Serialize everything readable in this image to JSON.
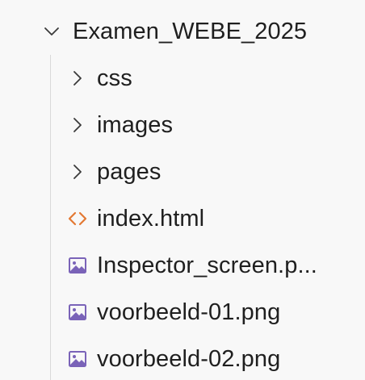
{
  "explorer": {
    "root": {
      "label": "Examen_WEBE_2025",
      "icon": "chevron-down-icon",
      "expanded": true
    },
    "items": [
      {
        "label": "css",
        "icon": "chevron-right-icon",
        "type": "folder"
      },
      {
        "label": "images",
        "icon": "chevron-right-icon",
        "type": "folder"
      },
      {
        "label": "pages",
        "icon": "chevron-right-icon",
        "type": "folder"
      },
      {
        "label": "index.html",
        "icon": "html-file-icon",
        "type": "file"
      },
      {
        "label": "Inspector_screen.p...",
        "icon": "image-file-icon",
        "type": "file"
      },
      {
        "label": "voorbeeld-01.png",
        "icon": "image-file-icon",
        "type": "file"
      },
      {
        "label": "voorbeeld-02.png",
        "icon": "image-file-icon",
        "type": "file"
      }
    ]
  },
  "colors": {
    "background": "#f8f8f8",
    "text": "#1f1f1f",
    "chevron": "#3a3a3a",
    "html_icon": "#e37933",
    "image_icon": "#7a63b8",
    "indent_guide": "#d9d9d9"
  }
}
